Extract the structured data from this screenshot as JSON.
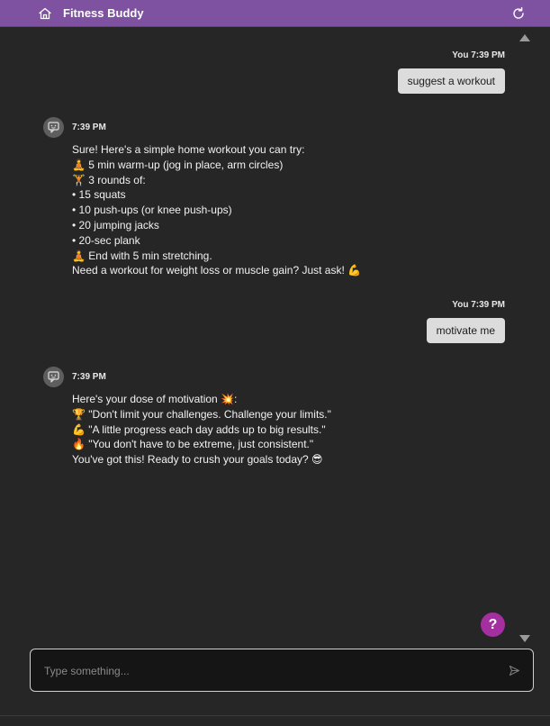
{
  "header": {
    "title": "Fitness Buddy",
    "home_icon": "home-icon",
    "refresh_icon": "refresh-icon",
    "accent_color": "#7e52a0"
  },
  "messages": [
    {
      "role": "user",
      "meta": "You 7:39 PM",
      "text": "suggest a workout"
    },
    {
      "role": "bot",
      "time": "7:39 PM",
      "lines": [
        "Sure! Here's a simple home workout you can try:",
        "🧘 5 min warm-up (jog in place, arm circles)",
        "🏋 3 rounds of:",
        "• 15 squats",
        "• 10 push-ups (or knee push-ups)",
        "• 20 jumping jacks",
        "• 20-sec plank",
        "🧘 End with 5 min stretching.",
        "Need a workout for weight loss or muscle gain? Just ask! 💪"
      ]
    },
    {
      "role": "user",
      "meta": "You 7:39 PM",
      "text": "motivate me"
    },
    {
      "role": "bot",
      "time": "7:39 PM",
      "lines": [
        "Here's your dose of motivation 💥:",
        "🏆 \"Don't limit your challenges. Challenge your limits.\"",
        "💪 \"A little progress each day adds up to big results.\"",
        "🔥 \"You don't have to be extreme, just consistent.\"",
        "You've got this! Ready to crush your goals today? 😎"
      ]
    }
  ],
  "help": {
    "label": "?"
  },
  "input": {
    "placeholder": "Type something...",
    "value": ""
  }
}
